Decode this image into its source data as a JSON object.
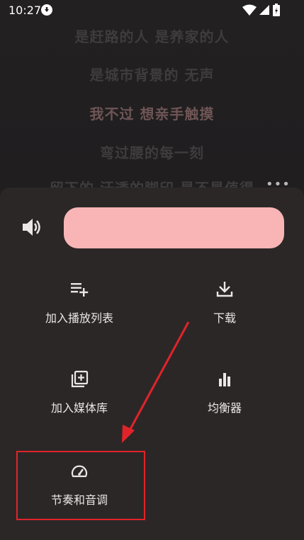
{
  "status_bar": {
    "time": "10:27"
  },
  "lyrics": [
    {
      "text": "是赶路的人 是养家的人",
      "state": "dim"
    },
    {
      "text": "是城市背景的 无声",
      "state": "dim"
    },
    {
      "text": "我不过 想亲手触摸",
      "state": "active"
    },
    {
      "text": "弯过腰的每一刻",
      "state": "dim"
    },
    {
      "text": "留下的 汗透的脚印 是不是值得",
      "state": "dim"
    }
  ],
  "sheet": {
    "more_label": "•••",
    "volume": {
      "level": 1.0
    },
    "actions": [
      {
        "label": "加入播放列表",
        "icon": "playlist-add-icon"
      },
      {
        "label": "下载",
        "icon": "download-icon"
      },
      {
        "label": "加入媒体库",
        "icon": "library-add-icon"
      },
      {
        "label": "均衡器",
        "icon": "equalizer-icon"
      },
      {
        "label": "节奏和音调",
        "icon": "speed-gauge-icon"
      }
    ]
  },
  "colors": {
    "volume_fill": "#f9b5b6",
    "highlight": "#e0242a",
    "sheet_bg": "#2c2727"
  }
}
